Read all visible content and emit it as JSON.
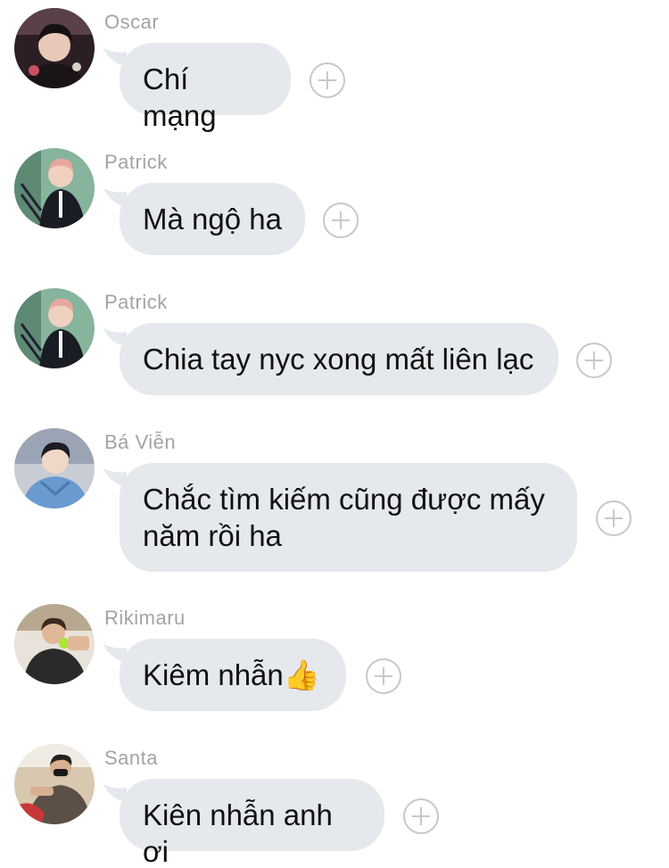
{
  "messages": [
    {
      "sender": "Oscar",
      "text": "Chí mạng",
      "avatar_color": "#3a2a30"
    },
    {
      "sender": "Patrick",
      "text": "Mà ngộ ha",
      "avatar_color": "#6f9a84"
    },
    {
      "sender": "Patrick",
      "text": "Chia tay nyc xong mất liên lạc",
      "avatar_color": "#6f9a84"
    },
    {
      "sender": "Bá Viễn",
      "text_line1": "Chắc tìm kiếm cũng được mấy",
      "text_line2": "năm rồi ha",
      "avatar_color": "#8aa0c0"
    },
    {
      "sender": "Rikimaru",
      "text": "Kiêm nhẫn",
      "emoji": "👍",
      "avatar_color": "#8a7a62"
    },
    {
      "sender": "Santa",
      "text": "Kiên nhẫn anh ơi",
      "avatar_color": "#7a6652"
    }
  ],
  "icons": {
    "add_reaction": "plus-circle-icon"
  },
  "colors": {
    "bubble": "#e5e8ec",
    "sender": "#a3a3a3",
    "add_icon": "#c8c8c8"
  }
}
